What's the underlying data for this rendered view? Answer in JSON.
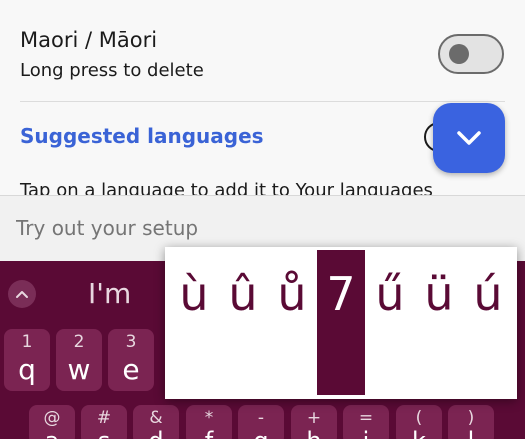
{
  "settings": {
    "language_name": "Maori / Māori",
    "language_sub": "Long press to delete",
    "toggle_on": false,
    "section_title": "Suggested languages",
    "hint": "Tap on a language to add it to Your languages"
  },
  "try_out": {
    "placeholder": "Try out your setup"
  },
  "keyboard": {
    "suggestion": "I'm",
    "row1": [
      {
        "num": "1",
        "letter": "q"
      },
      {
        "num": "2",
        "letter": "w"
      },
      {
        "num": "3",
        "letter": "e"
      }
    ],
    "row2_symbols": [
      "@",
      "#",
      "&",
      "*",
      "-",
      "+",
      "=",
      "(",
      ")"
    ],
    "row2_letters": [
      "a",
      "s",
      "d",
      "f",
      "g",
      "h",
      "j",
      "k",
      "l"
    ]
  },
  "accent_popup": {
    "chars": [
      "ù",
      "û",
      "ů",
      "7",
      "ű",
      "ü",
      "ú"
    ],
    "selected_index": 3
  },
  "colors": {
    "keyboard_bg": "#5a0a35",
    "key_bg": "#7b2452",
    "accent": "#3a63d6",
    "fab": "#3a63e0"
  },
  "icons": {
    "fab": "chevron-down-icon",
    "collapse": "chevron-up-icon"
  }
}
